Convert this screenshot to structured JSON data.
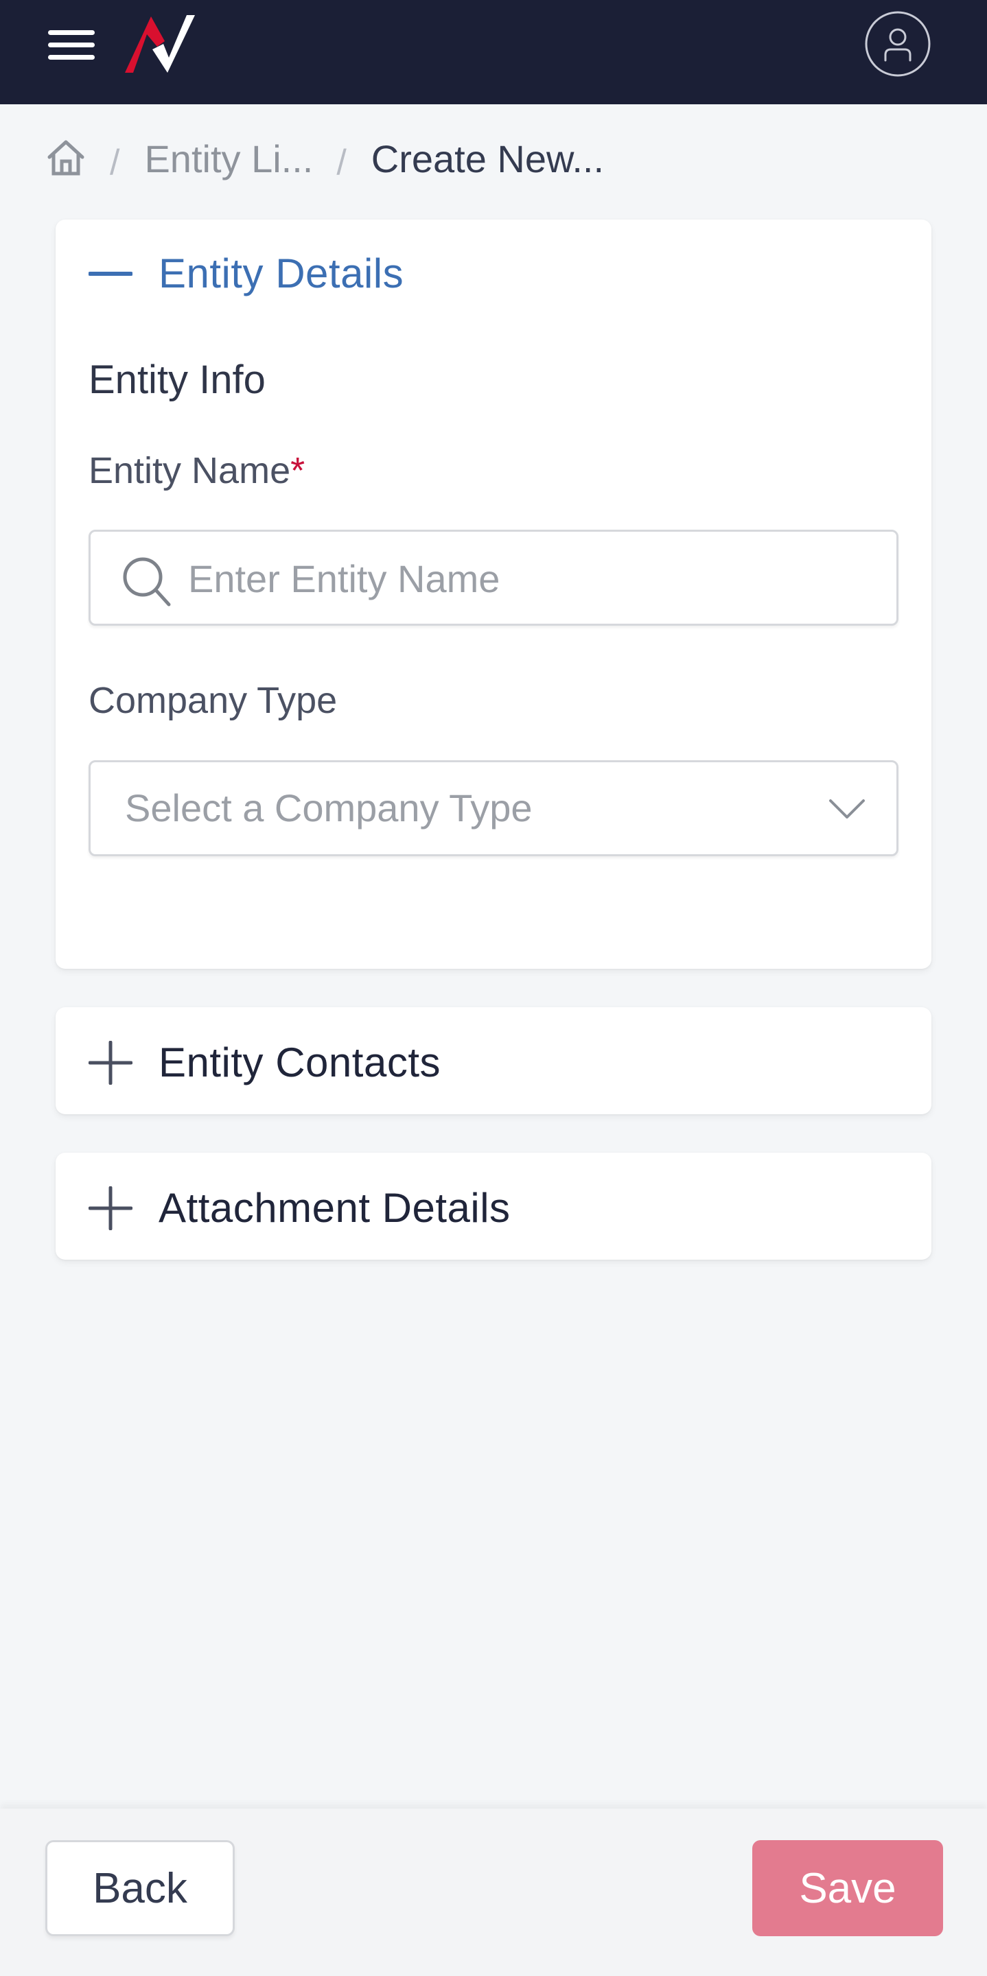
{
  "header": {
    "menu_icon": "hamburger-menu-icon",
    "logo": "brand-logo",
    "profile_icon": "user-profile-icon",
    "colors": {
      "background": "#1b1f36",
      "logo_red": "#d8102f",
      "logo_white": "#ffffff"
    }
  },
  "breadcrumb": {
    "home_icon": "home-icon",
    "separator": "/",
    "items": [
      {
        "label": "Entity Li..."
      },
      {
        "label": "Create New..."
      }
    ]
  },
  "sections": [
    {
      "title": "Entity Details",
      "expanded": true,
      "toggle_icon": "minus-icon",
      "subsection_title": "Entity Info",
      "fields": {
        "entity_name": {
          "label": "Entity Name",
          "required_marker": "*",
          "placeholder": "Enter Entity Name",
          "value": "",
          "icon": "search-icon"
        },
        "company_type": {
          "label": "Company Type",
          "placeholder": "Select a Company Type",
          "icon": "chevron-down-icon"
        }
      }
    },
    {
      "title": "Entity Contacts",
      "expanded": false,
      "toggle_icon": "plus-icon"
    },
    {
      "title": "Attachment Details",
      "expanded": false,
      "toggle_icon": "plus-icon"
    }
  ],
  "footer": {
    "back_label": "Back",
    "save_label": "Save"
  },
  "colors": {
    "accent_blue": "#3c6fb3",
    "required_red": "#c8103a",
    "save_button": "#e37b8f",
    "page_background": "#f4f6f8"
  }
}
